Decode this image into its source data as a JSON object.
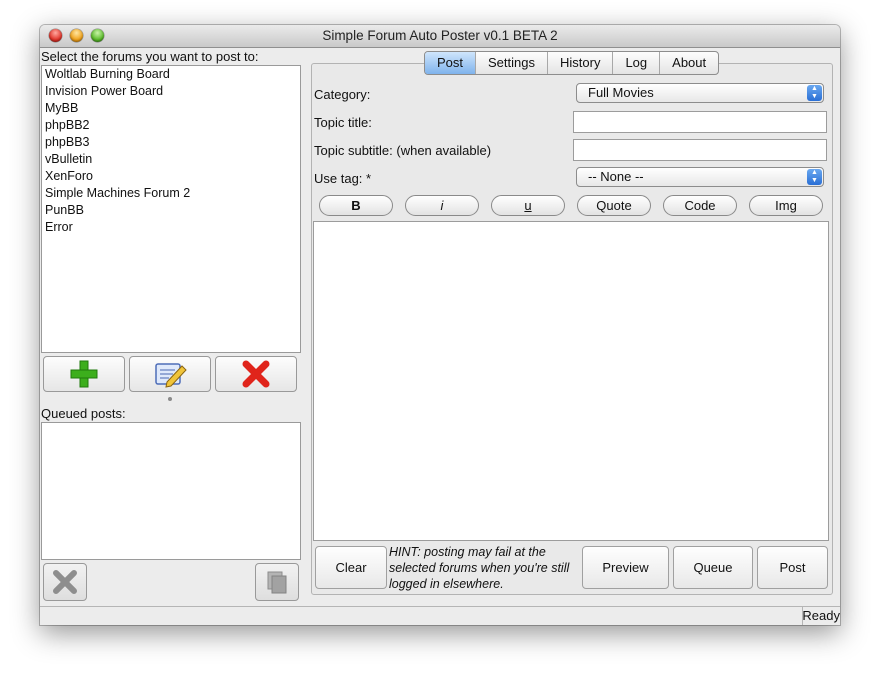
{
  "window": {
    "title": "Simple Forum Auto Poster v0.1 BETA 2"
  },
  "left": {
    "forums_label": "Select the forums you want to post to:",
    "forums": [
      "Woltlab Burning Board",
      "Invision Power Board",
      "MyBB",
      "phpBB2",
      "phpBB3",
      "vBulletin",
      "XenForo",
      "Simple Machines Forum 2",
      "PunBB",
      "Error"
    ],
    "add_icon": "plus-icon",
    "edit_icon": "edit-icon",
    "delete_icon": "x-icon",
    "queued_label": "Queued posts:",
    "remove_queue_icon": "gray-x-icon",
    "copy_icon": "copy-icon"
  },
  "tabs": [
    "Post",
    "Settings",
    "History",
    "Log",
    "About"
  ],
  "form": {
    "category_label": "Category:",
    "category_value": "Full Movies",
    "topic_title_label": "Topic title:",
    "topic_title_value": "",
    "topic_subtitle_label": "Topic subtitle: (when available)",
    "topic_subtitle_value": "",
    "tag_label": "Use tag: *",
    "tag_value": "-- None --"
  },
  "format_buttons": {
    "bold": "B",
    "italic": "i",
    "underline": "u",
    "quote": "Quote",
    "code": "Code",
    "img": "Img"
  },
  "actions": {
    "clear": "Clear",
    "hint": "HINT: posting may fail at the selected forums when you're still logged in elsewhere.",
    "preview": "Preview",
    "queue": "Queue",
    "post": "Post"
  },
  "status": "Ready",
  "colors": {
    "selected_tab": "#7fb3ec",
    "add_green": "#3cae1c",
    "delete_red": "#e0241b"
  }
}
